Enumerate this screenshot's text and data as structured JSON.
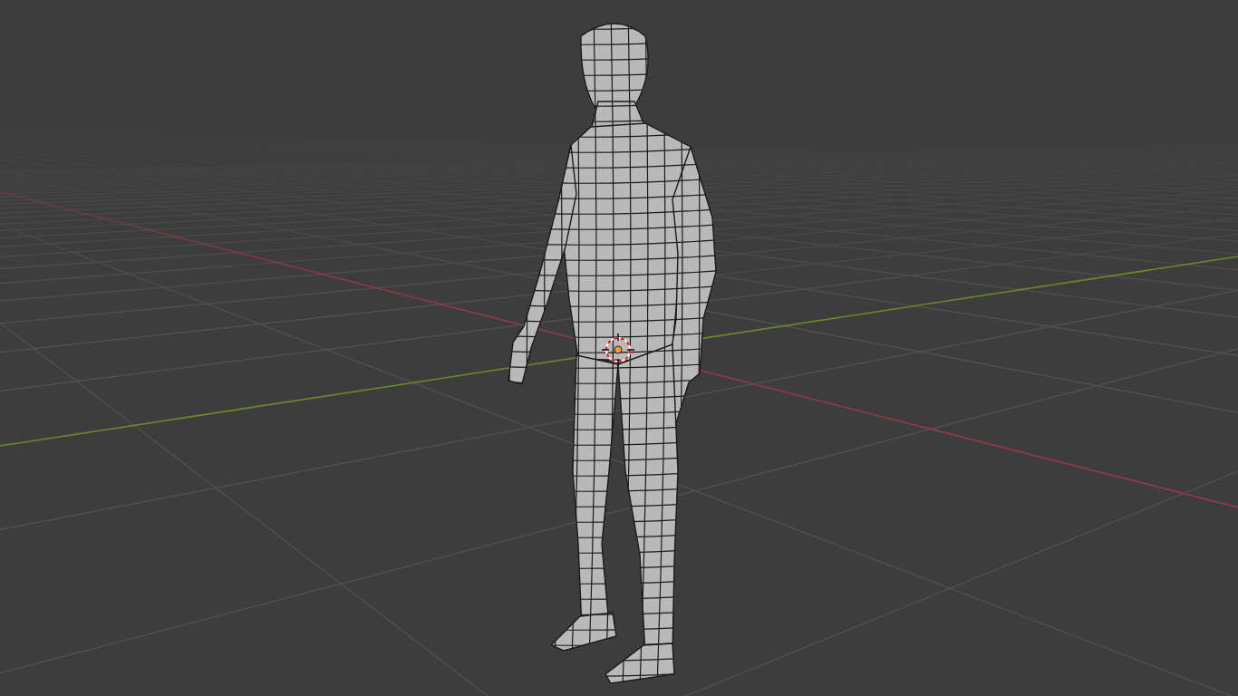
{
  "viewport": {
    "overlays": {
      "floor_grid": true,
      "x_axis": true,
      "y_axis": true
    },
    "cursor_3d": true,
    "objects": [
      {
        "kind": "mesh",
        "origin_shown": true
      }
    ]
  }
}
